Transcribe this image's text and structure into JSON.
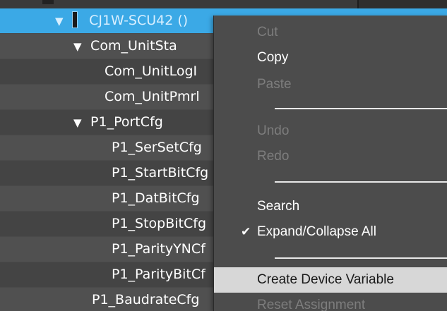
{
  "tree": {
    "rows": [
      {
        "label": "CJ1W-SCU42 ()",
        "expander": "▼"
      },
      {
        "label": "Com_UnitSta",
        "expander": "▼"
      },
      {
        "label": "Com_UnitLogI",
        "expander": ""
      },
      {
        "label": "Com_UnitPmrl",
        "expander": ""
      },
      {
        "label": "P1_PortCfg",
        "expander": "▼"
      },
      {
        "label": "P1_SerSetCfg",
        "expander": ""
      },
      {
        "label": "P1_StartBitCfg",
        "expander": ""
      },
      {
        "label": "P1_DatBitCfg",
        "expander": ""
      },
      {
        "label": "P1_StopBitCfg",
        "expander": ""
      },
      {
        "label": "P1_ParityYNCf",
        "expander": ""
      },
      {
        "label": "P1_ParityBitCf",
        "expander": ""
      },
      {
        "label": "P1_BaudrateCfg",
        "expander": ""
      }
    ]
  },
  "context_menu": {
    "items": {
      "cut": "Cut",
      "copy": "Copy",
      "paste": "Paste",
      "undo": "Undo",
      "redo": "Redo",
      "search": "Search",
      "expand_collapse_all": "Expand/Collapse All",
      "expand_check": "✔",
      "create_device_variable": "Create Device Variable",
      "reset_assignment": "Reset Assignment"
    }
  },
  "colors": {
    "selection": "#3ba9e6",
    "menu_background": "#4c4c4c",
    "menu_hover": "#d7d7d7",
    "disabled_text": "#7d7d7d"
  }
}
